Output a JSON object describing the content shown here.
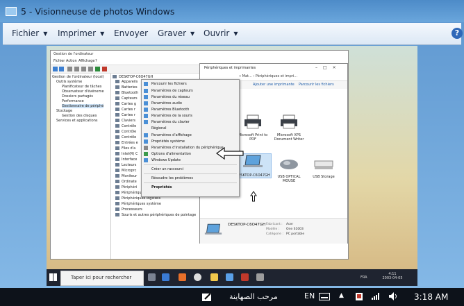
{
  "window": {
    "title": "5 - Visionneuse de photos Windows"
  },
  "menu": [
    {
      "label": "Fichier",
      "dropdown": true
    },
    {
      "label": "Imprimer",
      "dropdown": true
    },
    {
      "label": "Envoyer",
      "dropdown": false
    },
    {
      "label": "Graver",
      "dropdown": true
    },
    {
      "label": "Ouvrir",
      "dropdown": true
    }
  ],
  "help_label": "?",
  "screenshot": {
    "computer_mgmt": {
      "title": "Gestion de l'ordinateur",
      "menu": [
        "Fichier",
        "Action",
        "Affichage",
        "?"
      ],
      "tree": [
        "Gestion de l'ordinateur (local)",
        "Outils système",
        "Planificateur de tâches",
        "Observateur d'événeme",
        "Dossiers partagés",
        "Performance",
        "Gestionnaire de périphé",
        "Stockage",
        "Gestion des disques",
        "Services et applications"
      ],
      "device_root": "DESKTOP-C6O47GH",
      "devices": [
        "Appareils",
        "Batteries",
        "Bluetooth",
        "Capteurs",
        "Cartes g",
        "Cartes r",
        "Cartes r",
        "Claviers",
        "Contrôle",
        "Contrôle",
        "Contrôle",
        "Entrées e",
        "Files d'a",
        "Intel(R) C",
        "Interface",
        "Lecteurs",
        "Microprc",
        "Moniteur",
        "Ordinate",
        "Périphéri",
        "Périphériques de sécurité",
        "Périphériques logiciels",
        "Périphériques système",
        "Processeurs",
        "Souris et autres périphériques de pointage"
      ]
    },
    "context_menu": {
      "items": [
        "Parcourir les fichiers",
        "Paramètres de capteurs",
        "Paramètres du réseau",
        "Paramètres audio",
        "Paramètres Bluetooth",
        "Paramètres de la souris",
        "Paramètres du clavier",
        "Régional",
        "Paramètres d'affichage",
        "Propriétés système",
        "Paramètres d'installation du périphérique",
        "Options d'alimentation",
        "Windows Update",
        "Créer un raccourci",
        "Résoudre les problèmes",
        "Propriétés"
      ]
    },
    "devices_printers": {
      "title": "Périphériques et imprimantes",
      "address": "« Mat... › Périphériques et impri...",
      "commands": [
        "Ajouter une imprimante",
        "Parcourir les fichiers"
      ],
      "printers": [
        "Microsoft Print to PDF",
        "Microsoft XPS Document Writer"
      ],
      "devices": [
        "DESKTOP-C6O47GH",
        "USB OPTICAL MOUSE",
        "USB Storage"
      ],
      "details": {
        "name": "DESKTOP-C6O47GH",
        "fabricant_label": "Fabricant :",
        "fabricant": "Acer",
        "modele_label": "Modèle :",
        "modele": "One S1003",
        "categorie_label": "Catégorie :",
        "categorie": "PC portable"
      }
    },
    "inner_taskbar": {
      "search_placeholder": "Taper ici pour rechercher",
      "lang": "FRA",
      "time": "4:11",
      "date": "2003-04-05"
    }
  },
  "taskbar": {
    "arabic_label": "مرحب الصهاينة",
    "lang": "EN",
    "time": "3:18 AM"
  }
}
